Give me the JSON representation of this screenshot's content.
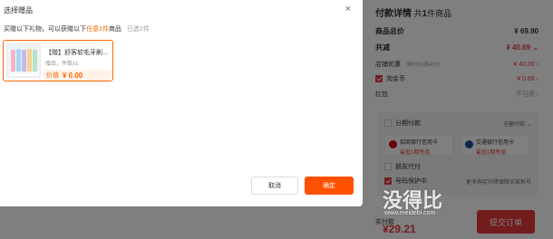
{
  "checkout": {
    "title_prefix": "付款详情",
    "title_count_pre": "共",
    "title_count": "1",
    "title_count_post": "件商品",
    "rows": {
      "goods_total_label": "商品总价",
      "goods_total_value": "¥ 69.90",
      "discount_total_label": "共减",
      "discount_total_value": "¥ 40.69",
      "shop_discount_label": "店铺优惠",
      "shop_discount_note": "满69元减40元",
      "shop_discount_value": "¥ 40.00",
      "coin_label": "淘金币",
      "coin_value": "¥ 0.69",
      "redpack_label": "红包",
      "redpack_value": "不可用"
    },
    "installment_label": "分期付款",
    "installment_option": "全额付款",
    "card1_title": "招商银行信用卡",
    "card1_sub": "最低1期免息",
    "card2_title": "交通银行信用卡",
    "card2_sub": "最低1期免息",
    "friend_pay_label": "朋友代付",
    "privacy_label": "号码保护中",
    "privacy_note": "更多购买升降保障买家机号",
    "total_label": "实付款",
    "total_value": "¥29.21",
    "submit_label": "提交订单"
  },
  "watermark": {
    "main": "没得比",
    "sub": "www.meidebi.com"
  },
  "modal": {
    "title": "选择赠品",
    "close": "×",
    "subtitle_pre": "买赠以下礼物，可以获赠以下",
    "subtitle_highlight": "任意1件",
    "subtitle_post": "商品",
    "subtitle_selected": "已选1件",
    "gift": {
      "name": "【赠】舒客软毛牙刷...",
      "meta": "赠品，件数x1",
      "price_label": "价值",
      "price_value": "¥ 0.00"
    },
    "cancel_label": "取消",
    "confirm_label": "确定"
  },
  "colors": {
    "accent": "#ff5000",
    "price_red": "#e4393c",
    "gift_orange": "#ff6600"
  }
}
